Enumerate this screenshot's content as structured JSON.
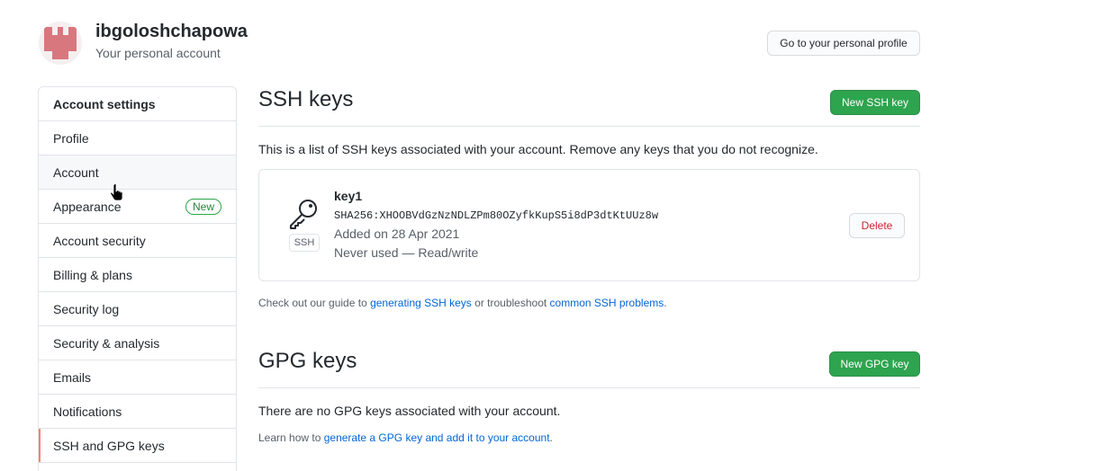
{
  "header": {
    "username": "ibgoloshchapowa",
    "subtitle": "Your personal account",
    "profile_button": "Go to your personal profile"
  },
  "sidebar": {
    "heading": "Account settings",
    "items": [
      {
        "label": "Profile"
      },
      {
        "label": "Account"
      },
      {
        "label": "Appearance",
        "badge": "New"
      },
      {
        "label": "Account security"
      },
      {
        "label": "Billing & plans"
      },
      {
        "label": "Security log"
      },
      {
        "label": "Security & analysis"
      },
      {
        "label": "Emails"
      },
      {
        "label": "Notifications"
      },
      {
        "label": "SSH and GPG keys"
      }
    ]
  },
  "ssh": {
    "title": "SSH keys",
    "new_button": "New SSH key",
    "description": "This is a list of SSH keys associated with your account. Remove any keys that you do not recognize.",
    "key": {
      "type_label": "SSH",
      "name": "key1",
      "fingerprint": "SHA256:XHOOBVdGzNzNDLZPm80OZyfkKupS5i8dP3dtKtUUz8w",
      "added": "Added on 28 Apr 2021",
      "usage": "Never used — Read/write",
      "delete_button": "Delete"
    },
    "guide": {
      "prefix": "Check out our guide to ",
      "link1": "generating SSH keys",
      "middle": " or troubleshoot ",
      "link2": "common SSH problems",
      "suffix": "."
    }
  },
  "gpg": {
    "title": "GPG keys",
    "new_button": "New GPG key",
    "empty_text": "There are no GPG keys associated with your account.",
    "learn": {
      "prefix": "Learn how to ",
      "link": "generate a GPG key and add it to your account",
      "suffix": "."
    }
  },
  "colors": {
    "primary_green": "#2ea44f",
    "link_blue": "#0366d6",
    "selected_accent": "#f9826c",
    "danger_red": "#cb2431",
    "avatar_pink": "#d9777f"
  },
  "icons": {
    "avatar": "identicon-avatar",
    "key": "key-icon",
    "cursor": "hand-pointer-cursor"
  }
}
